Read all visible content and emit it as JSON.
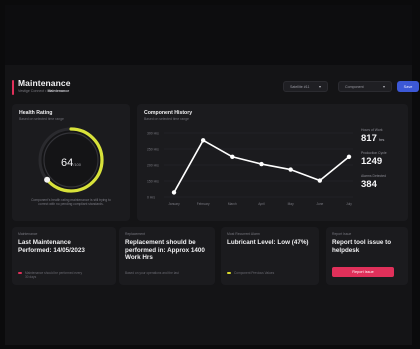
{
  "header": {
    "title": "Maintenance",
    "breadcrumb_prefix": "Vestige Connect •",
    "breadcrumb_current": "Maintenance"
  },
  "toolbar": {
    "select1": "Satellite #11",
    "select2": "Component",
    "button": "Save"
  },
  "health": {
    "title": "Health Rating",
    "subtitle": "Based on selected time range",
    "value": "64",
    "max": "/100",
    "percent": 64,
    "caption": "Component's health rating maintenance is still trying to correct with no pending compliant standards."
  },
  "history": {
    "title": "Component History",
    "subtitle": "Based on selected time range",
    "stats": [
      {
        "label": "Hours of Work",
        "value": "817",
        "unit": "hrs"
      },
      {
        "label": "Production Cycle",
        "value": "1249",
        "unit": ""
      },
      {
        "label": "Alarms Detected",
        "value": "384",
        "unit": ""
      }
    ]
  },
  "chart_data": {
    "type": "line",
    "categories": [
      "January",
      "February",
      "March",
      "April",
      "May",
      "June",
      "July"
    ],
    "values": [
      25,
      310,
      220,
      180,
      150,
      90,
      220
    ],
    "y_ticks": [
      "300 Hrs",
      "250 Hrs",
      "200 Hrs",
      "150 Hrs",
      "0 Hrs"
    ],
    "ylim": [
      0,
      350
    ],
    "grid": true,
    "line_color": "#ffffff"
  },
  "cards": [
    {
      "label": "Maintenance",
      "text": "Last Maintenance Performed: 14/05/2023",
      "foot": "Maintenance should be performed every 30 days",
      "dot_color": "#e0305a"
    },
    {
      "label": "Replacement",
      "text": "Replacement should be performed in: Approx 1400 Work Hrs",
      "foot": "Based on your operations and the last",
      "dot_color": ""
    },
    {
      "label": "Most Recurrent Alarm",
      "text": "Lubricant Level: Low (47%)",
      "foot": "Component Previous Values",
      "dot_color": "#d9d92b"
    },
    {
      "label": "Report Issue",
      "text": "Report tool issue to helpdesk",
      "button": "Report Issue"
    }
  ],
  "colors": {
    "accent": "#e0305a",
    "ring": "#d8e23a",
    "primary": "#3c58d6"
  }
}
